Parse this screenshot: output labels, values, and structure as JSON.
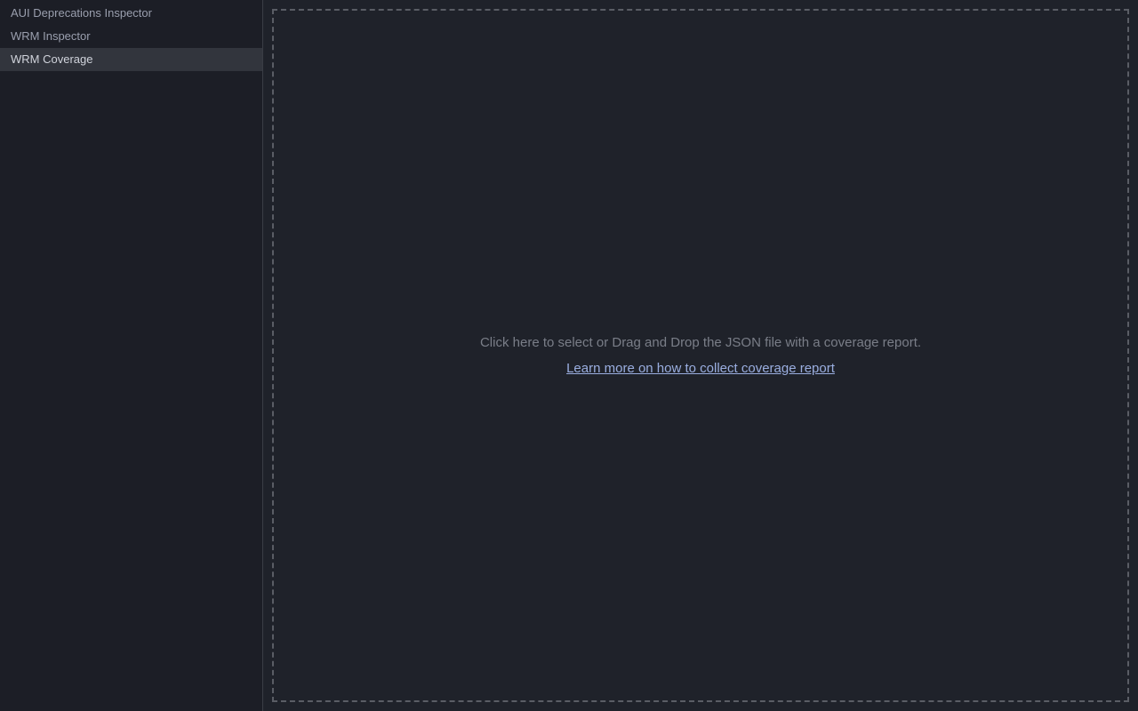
{
  "sidebar": {
    "items": [
      {
        "label": "AUI Deprecations Inspector",
        "selected": false
      },
      {
        "label": "WRM Inspector",
        "selected": false
      },
      {
        "label": "WRM Coverage",
        "selected": true
      }
    ]
  },
  "main": {
    "dropzone": {
      "instruction": "Click here to select or Drag and Drop the JSON file with a coverage report.",
      "link_text": "Learn more on how to collect coverage report"
    }
  }
}
